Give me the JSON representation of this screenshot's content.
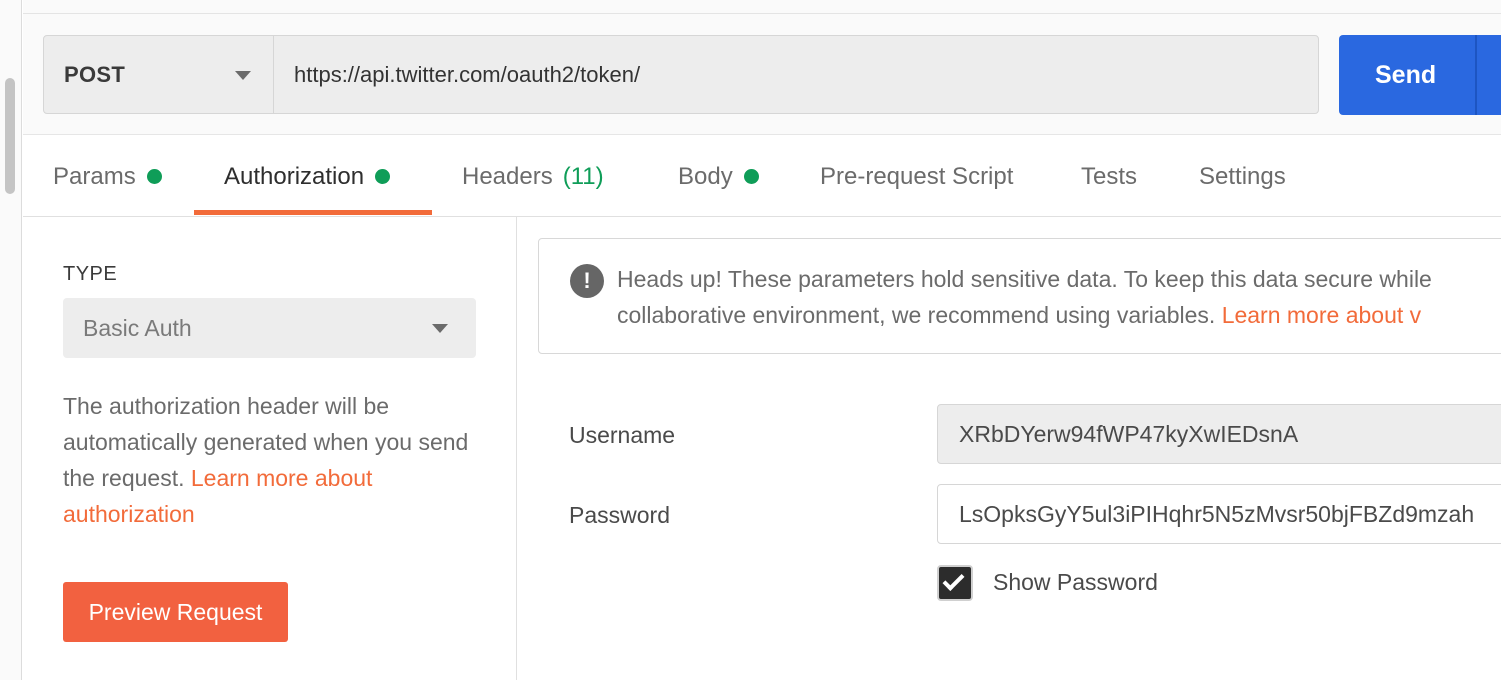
{
  "request": {
    "method": "POST",
    "url": "https://api.twitter.com/oauth2/token/",
    "send_label": "Send"
  },
  "tabs": [
    {
      "label": "Params",
      "indicator": "dot"
    },
    {
      "label": "Authorization",
      "indicator": "dot",
      "active": true
    },
    {
      "label": "Headers",
      "count": "(11)"
    },
    {
      "label": "Body",
      "indicator": "dot"
    },
    {
      "label": "Pre-request Script"
    },
    {
      "label": "Tests"
    },
    {
      "label": "Settings"
    }
  ],
  "auth": {
    "type_label": "TYPE",
    "type_value": "Basic Auth",
    "description": "The authorization header will be automatically generated when you send the request.",
    "learn_more_link": "Learn more about authorization",
    "preview_button": "Preview Request"
  },
  "alert": {
    "line1": "Heads up! These parameters hold sensitive data. To keep this data secure while",
    "line2": "collaborative environment, we recommend using variables.",
    "link": "Learn more about v"
  },
  "fields": {
    "username_label": "Username",
    "username_value": "XRbDYerw94fWP47kyXwIEDsnA",
    "password_label": "Password",
    "password_value": "LsOpksGyY5ul3iPIHqhr5N5zMvsr50bjFBZd9mzah",
    "show_password_label": "Show Password",
    "show_password_checked": true
  },
  "colors": {
    "accent": "#f26b3a",
    "send": "#2a68e0",
    "indicator": "#0f9d58"
  }
}
